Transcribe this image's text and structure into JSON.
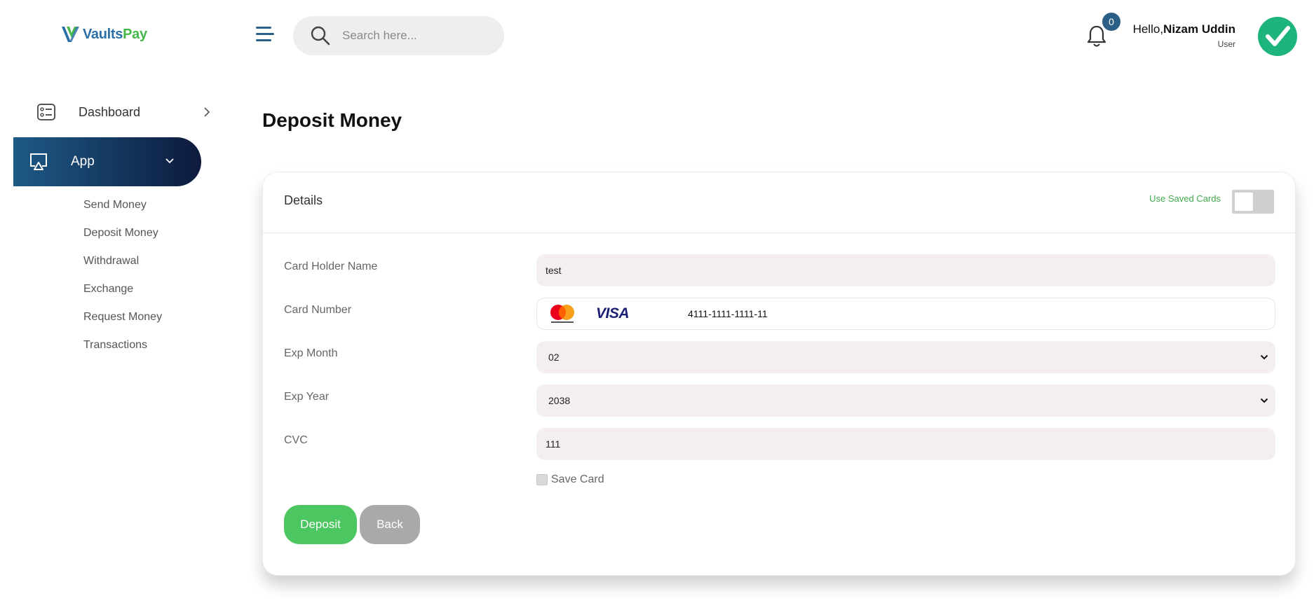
{
  "brand": {
    "name_part1": "Vaults",
    "name_part2": "Pay",
    "primary": "#2b6fa8",
    "accent": "#46b84a"
  },
  "header": {
    "search_placeholder": "Search here...",
    "search_icon": "search-icon",
    "menu_icon": "hamburger-menu-icon",
    "notification_count": "0",
    "greeting_prefix": "Hello,",
    "user_name": "Nizam Uddin",
    "user_role": "User",
    "avatar_icon": "checkmark-icon"
  },
  "sidebar": {
    "dashboard_label": "Dashboard",
    "app_label": "App",
    "app_items": [
      "Send Money",
      "Deposit Money",
      "Withdrawal",
      "Exchange",
      "Request Money",
      "Transactions"
    ]
  },
  "main": {
    "page_title": "Deposit Money",
    "card_title": "Details",
    "use_saved_cards_label": "Use Saved Cards",
    "use_saved_cards_on": false,
    "fields": {
      "holder_label": "Card Holder Name",
      "holder_value": "test",
      "number_label": "Card Number",
      "number_value": "4111-1111-1111-11",
      "visa_text": "VISA",
      "month_label": "Exp Month",
      "month_value": "02",
      "year_label": "Exp Year",
      "year_value": "2038",
      "cvc_label": "CVC",
      "cvc_value": "111"
    },
    "save_card_label": "Save Card",
    "save_card_checked": false,
    "deposit_button": "Deposit",
    "back_button": "Back"
  }
}
